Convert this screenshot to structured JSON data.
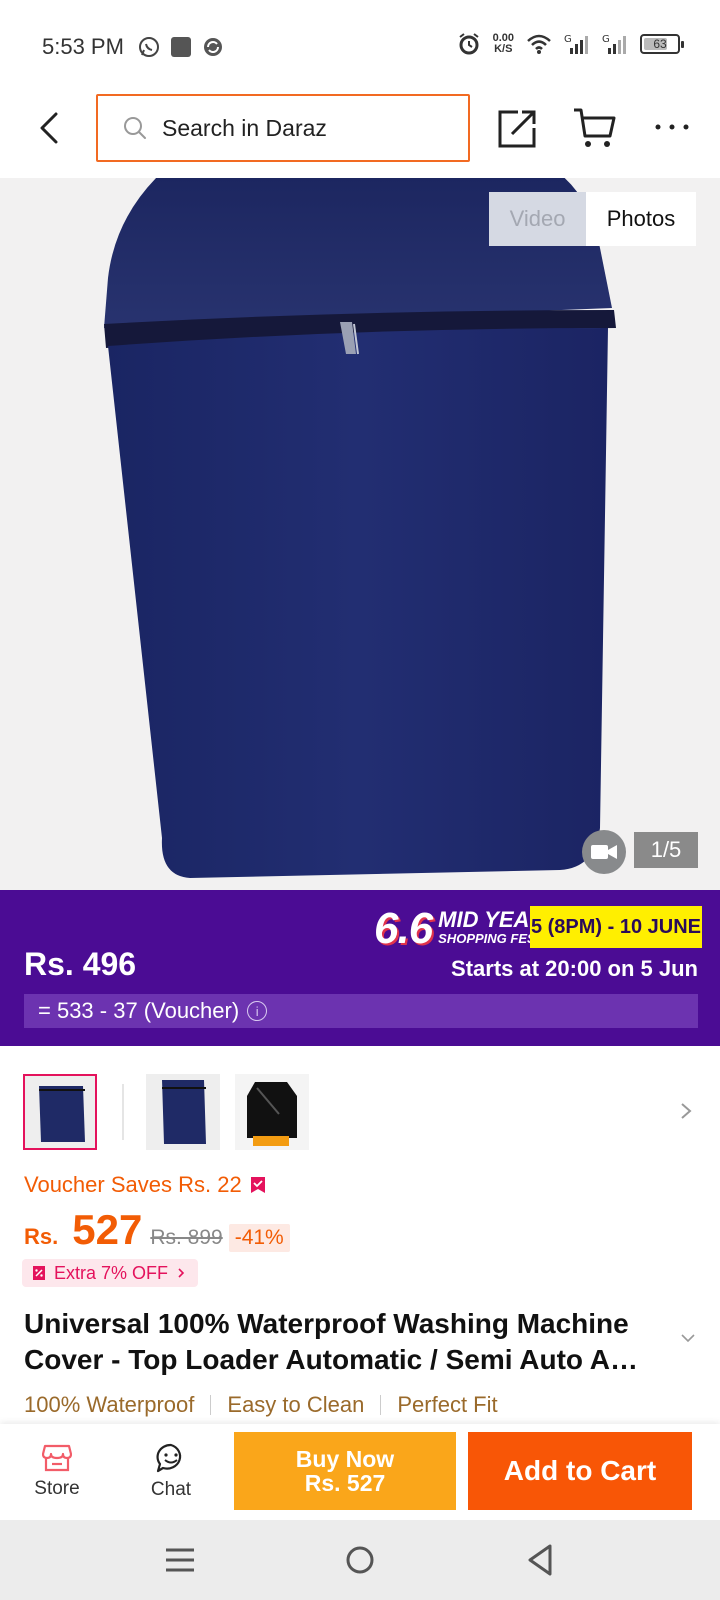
{
  "status_bar": {
    "time": "5:53 PM",
    "net_speed_value": "0.00",
    "net_speed_unit": "K/S",
    "battery": "63",
    "signal_label": "G"
  },
  "header": {
    "search_placeholder": "Search in Daraz"
  },
  "gallery": {
    "tab_video": "Video",
    "tab_photos": "Photos",
    "counter": "1/5"
  },
  "promo": {
    "fest_number": "6.6",
    "fest_line1": "MID YEAR",
    "fest_line2": "SHOPPING FEST!",
    "fest_dates": "5 (8PM) - 10 JUNE",
    "price": "Rs. 496",
    "starts": "Starts at 20:00 on 5 Jun",
    "formula": "= 533 - 37 (Voucher)",
    "info_icon": "i"
  },
  "product": {
    "voucher_saves": "Voucher Saves Rs. 22",
    "currency": "Rs.",
    "price": "527",
    "original_price": "Rs. 899",
    "discount": "-41%",
    "extra_off": "Extra 7% OFF",
    "title": "Universal 100% Waterproof Washing Machine Cover - Top Loader Automatic / Semi Auto A…",
    "features": [
      "100% Waterproof",
      "Easy to Clean",
      "Perfect Fit"
    ]
  },
  "action_bar": {
    "store_label": "Store",
    "chat_label": "Chat",
    "buy_now_line1": "Buy Now",
    "buy_now_line2": "Rs. 527",
    "add_to_cart": "Add to Cart"
  },
  "colors": {
    "accent_orange": "#f85606",
    "buy_now_yellow": "#faa61a",
    "promo_purple": "#4b0c94",
    "product_navy": "#1f2a66",
    "pink": "#e4125c"
  }
}
